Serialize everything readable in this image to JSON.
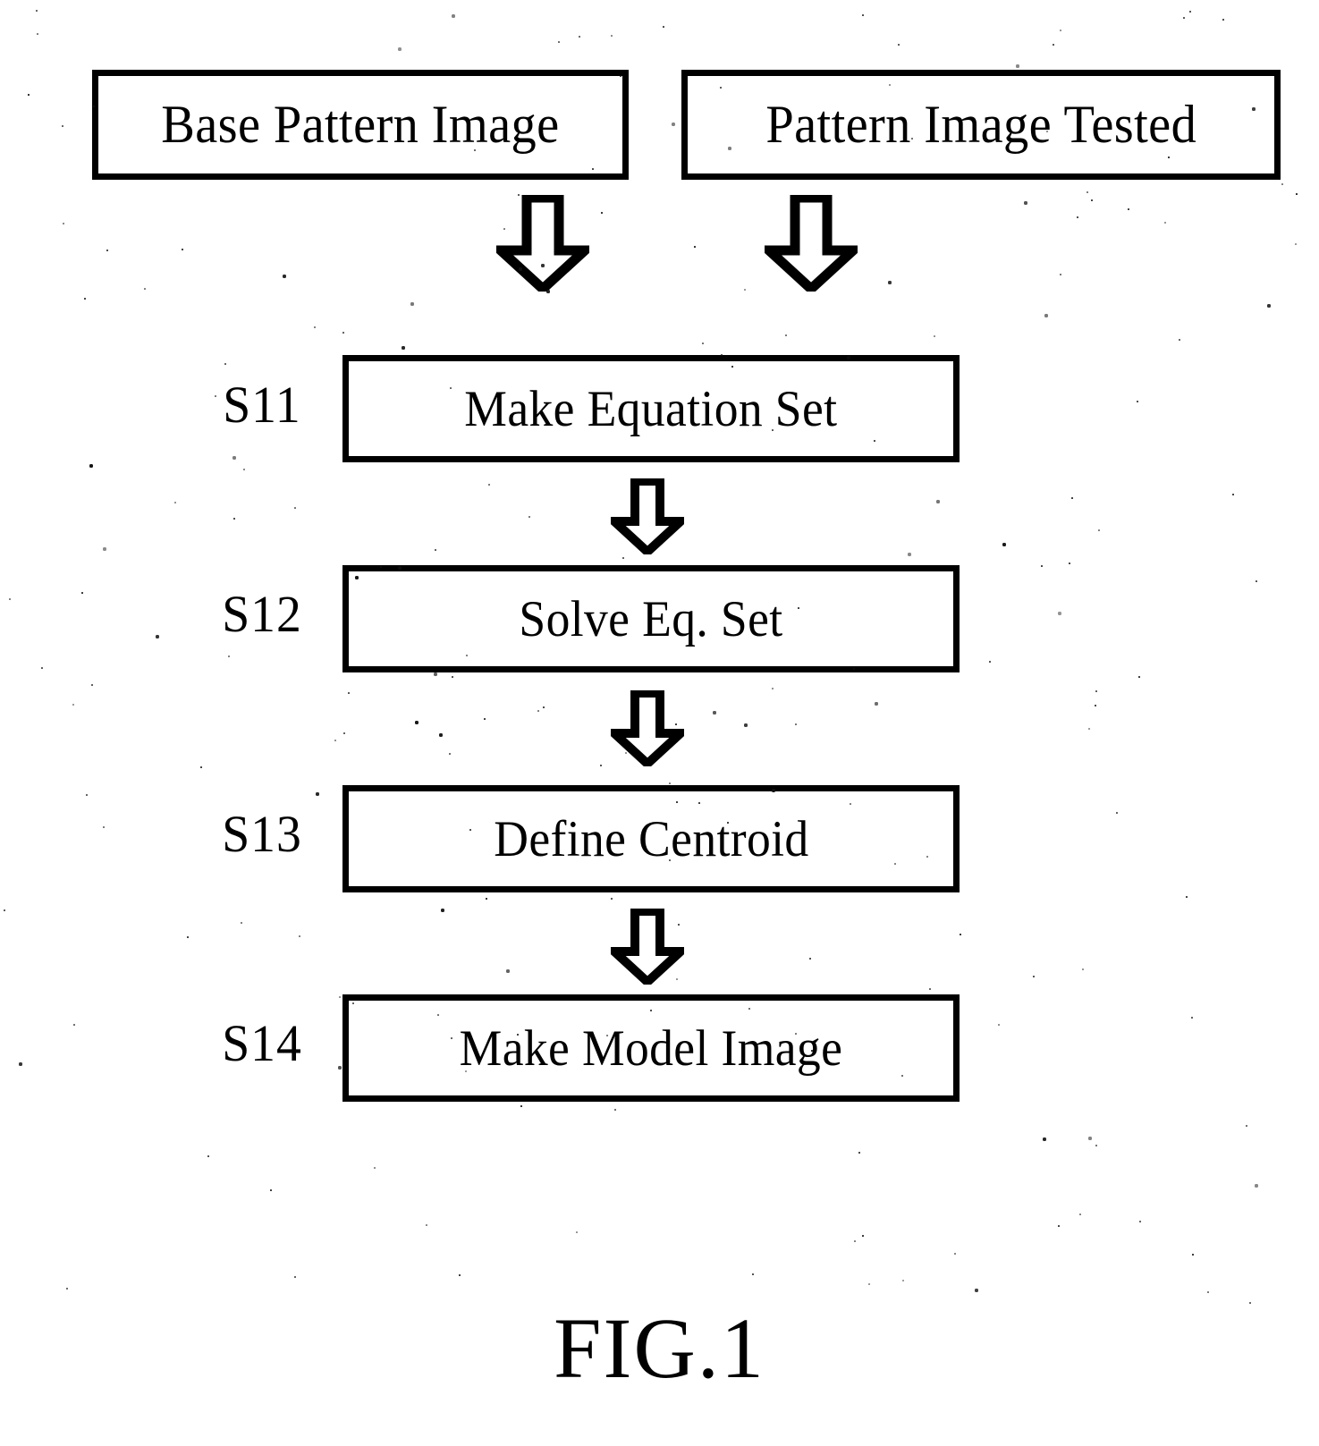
{
  "figure": {
    "caption": "FIG.1",
    "background_color": "#ffffff",
    "ink_color": "#000000"
  },
  "inputs": [
    {
      "id": "base-pattern-image",
      "label": "Base Pattern Image"
    },
    {
      "id": "pattern-image-tested",
      "label": "Pattern Image Tested"
    }
  ],
  "steps": [
    {
      "id": "S11",
      "step_id": "S11",
      "label": "Make Equation Set"
    },
    {
      "id": "S12",
      "step_id": "S12",
      "label": "Solve Eq. Set"
    },
    {
      "id": "S13",
      "step_id": "S13",
      "label": "Define Centroid"
    },
    {
      "id": "S14",
      "step_id": "S14",
      "label": "Make Model Image"
    }
  ],
  "arrows": [
    {
      "id": "base-to-s11",
      "icon": "down-block-arrow-icon",
      "from": "Base Pattern Image",
      "to": "Make Equation Set"
    },
    {
      "id": "tested-to-s11",
      "icon": "down-block-arrow-icon",
      "from": "Pattern Image Tested",
      "to": "Make Equation Set"
    },
    {
      "id": "s11-to-s12",
      "icon": "down-block-arrow-icon",
      "from": "Make Equation Set",
      "to": "Solve Eq. Set"
    },
    {
      "id": "s12-to-s13",
      "icon": "down-block-arrow-icon",
      "from": "Solve Eq. Set",
      "to": "Define Centroid"
    },
    {
      "id": "s13-to-s14",
      "icon": "down-block-arrow-icon",
      "from": "Define Centroid",
      "to": "Make Model Image"
    }
  ]
}
